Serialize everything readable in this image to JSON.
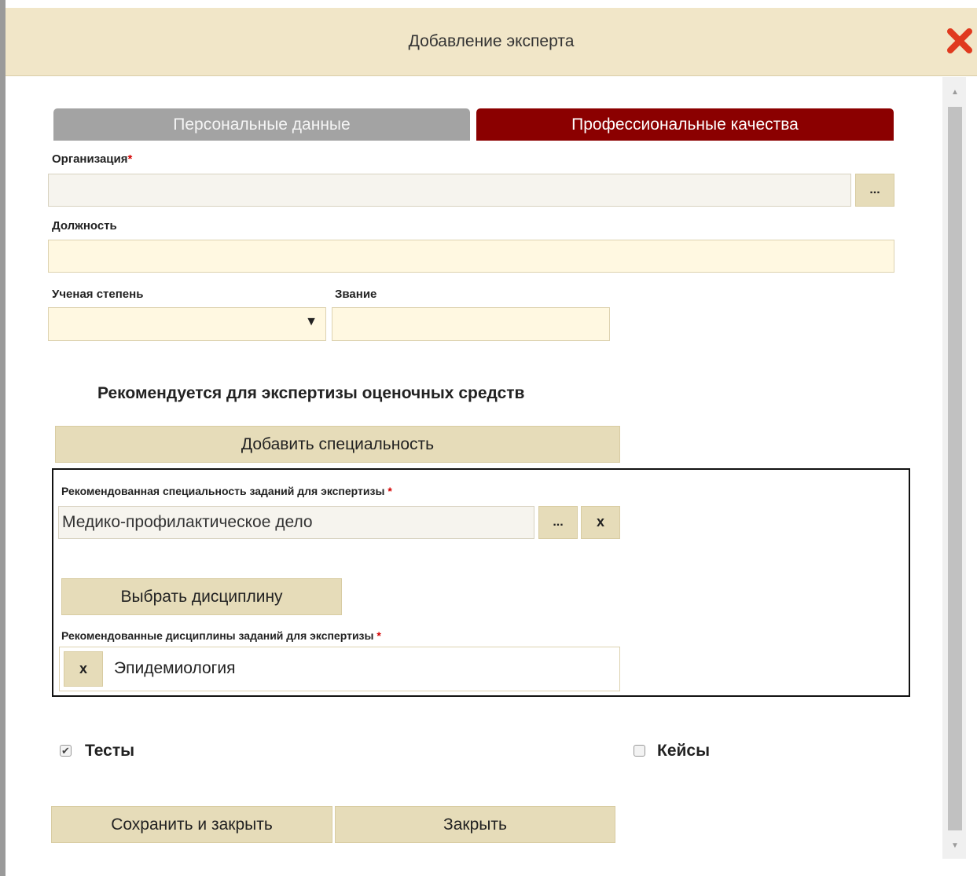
{
  "dialog": {
    "title": "Добавление эксперта",
    "close_icon": "close-icon"
  },
  "tabs": [
    {
      "label": "Персональные данные",
      "active": false
    },
    {
      "label": "Профессиональные качества",
      "active": true
    }
  ],
  "form": {
    "organization_label": "Организация",
    "organization_value": "",
    "organization_button": "...",
    "position_label": "Должность",
    "position_value": "",
    "degree_label": "Ученая степень",
    "degree_value": "",
    "degree_arrow": "▼",
    "title_label": "Звание",
    "title_value": ""
  },
  "recommend": {
    "heading": "Рекомендуется для экспертизы оценочных средств",
    "add_specialty_button": "Добавить специальность",
    "specialty_label": "Рекомендованная специальность заданий для экспертизы",
    "specialty_value": "Медико-профилактическое дело",
    "specialty_select_button": "...",
    "specialty_remove_button": "x",
    "choose_discipline_button": "Выбрать дисциплину",
    "disciplines_label": "Рекомендованные дисциплины заданий для экспертизы",
    "disciplines": [
      {
        "name": "Эпидемиология",
        "remove_label": "x"
      }
    ]
  },
  "required_mark": "*",
  "checkboxes": [
    {
      "label": "Тесты",
      "checked": true,
      "mark": "✔"
    },
    {
      "label": "Кейсы",
      "checked": false,
      "mark": ""
    }
  ],
  "footer": {
    "save_close_button": "Сохранить и закрыть",
    "close_button": "Закрыть"
  },
  "colors": {
    "header_bg": "#f1e6c8",
    "active_tab": "#8b0000",
    "inactive_tab": "#a3a3a3",
    "button_bg": "#e6dcb9",
    "field_bg": "#fff8e1",
    "close_icon": "#e03a1f"
  }
}
